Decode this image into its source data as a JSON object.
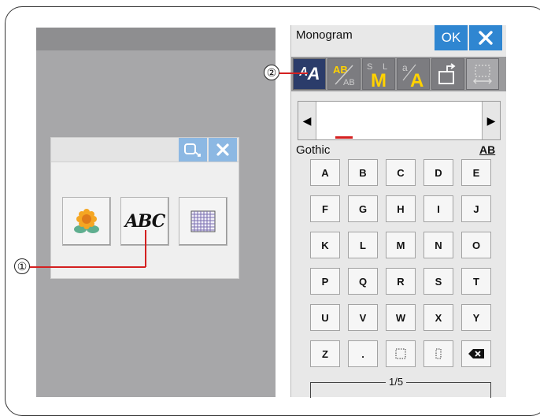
{
  "callouts": {
    "one": "①",
    "two": "②"
  },
  "left_dialog": {
    "tiles": [
      "flower-pattern",
      "ABC",
      "grid-pattern"
    ],
    "abc_text": "ABC"
  },
  "right": {
    "title": "Monogram",
    "ok_label": "OK",
    "font_name": "Gothic",
    "case_label": "AB",
    "page_indicator": "1/5",
    "keys": [
      "A",
      "B",
      "C",
      "D",
      "E",
      "F",
      "G",
      "H",
      "I",
      "J",
      "K",
      "L",
      "M",
      "N",
      "O",
      "P",
      "Q",
      "R",
      "S",
      "T",
      "U",
      "V",
      "W",
      "X",
      "Y",
      "Z",
      ".",
      "",
      "",
      ""
    ]
  },
  "colors": {
    "accent": "#2f86d1",
    "active_tool": "#2b3c6a",
    "callout_line": "#d42020"
  }
}
